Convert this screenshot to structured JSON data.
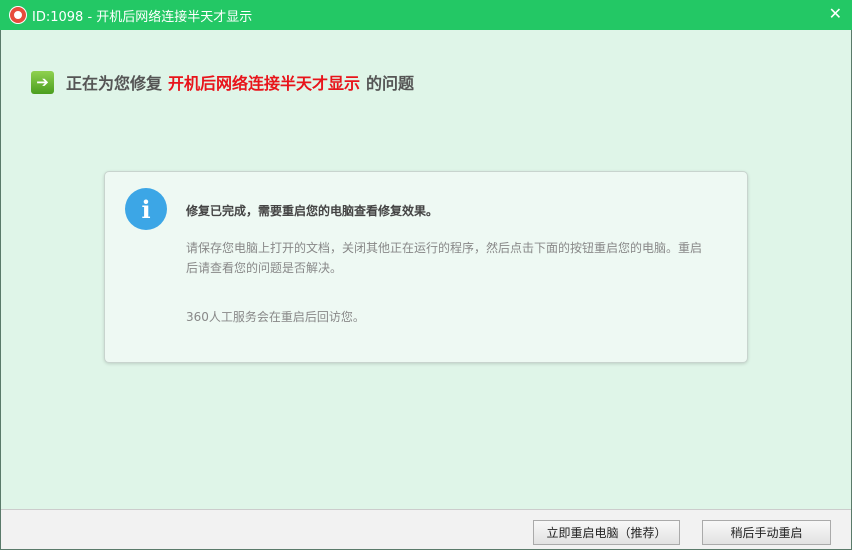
{
  "window": {
    "title": "ID:1098 - 开机后网络连接半天才显示"
  },
  "heading": {
    "prefix": "正在为您修复",
    "problem": "开机后网络连接半天才显示",
    "suffix": "的问题"
  },
  "card": {
    "title": "修复已完成，需要重启您的电脑查看修复效果。",
    "body": "请保存您电脑上打开的文档，关闭其他正在运行的程序，然后点击下面的按钮重启您的电脑。重启后请查看您的问题是否解决。",
    "note": "360人工服务会在重启后回访您。"
  },
  "buttons": {
    "restart_now": "立即重启电脑（推荐）",
    "restart_later": "稍后手动重启"
  }
}
